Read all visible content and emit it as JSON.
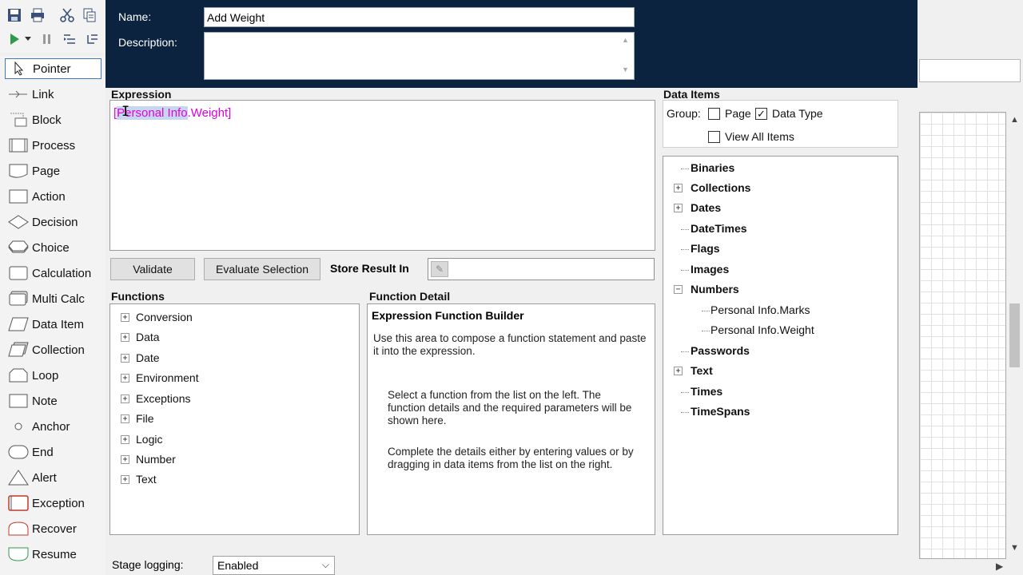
{
  "toolbar": {
    "icons": [
      "save-icon",
      "print-icon",
      "cut-icon",
      "copy-icon",
      "play-icon",
      "dropdown-icon",
      "pause-icon",
      "step-icon",
      "step-over-icon"
    ]
  },
  "palette": {
    "items": [
      {
        "label": "Pointer"
      },
      {
        "label": "Link"
      },
      {
        "label": "Block"
      },
      {
        "label": "Process"
      },
      {
        "label": "Page"
      },
      {
        "label": "Action"
      },
      {
        "label": "Decision"
      },
      {
        "label": "Choice"
      },
      {
        "label": "Calculation"
      },
      {
        "label": "Multi Calc"
      },
      {
        "label": "Data Item"
      },
      {
        "label": "Collection"
      },
      {
        "label": "Loop"
      },
      {
        "label": "Note"
      },
      {
        "label": "Anchor"
      },
      {
        "label": "End"
      },
      {
        "label": "Alert"
      },
      {
        "label": "Exception"
      },
      {
        "label": "Recover"
      },
      {
        "label": "Resume"
      }
    ],
    "selected": "Pointer"
  },
  "dialog": {
    "name_label": "Name:",
    "name_value": "Add Weight",
    "description_label": "Description:",
    "description_value": "",
    "expression_label": "Expression",
    "expression": {
      "open": "[",
      "highlighted": "Personal Info",
      "rest": ".Weight]"
    },
    "validate_button": "Validate",
    "evaluate_button": "Evaluate Selection",
    "store_result_label": "Store Result In",
    "store_result_value": "",
    "functions_label": "Functions",
    "functions": [
      {
        "label": "Conversion"
      },
      {
        "label": "Data"
      },
      {
        "label": "Date"
      },
      {
        "label": "Environment"
      },
      {
        "label": "Exceptions"
      },
      {
        "label": "File"
      },
      {
        "label": "Logic"
      },
      {
        "label": "Number"
      },
      {
        "label": "Text"
      }
    ],
    "function_detail_label": "Function Detail",
    "function_detail": {
      "title": "Expression Function Builder",
      "p1": "Use this area to compose a function statement and paste it into the expression.",
      "p2": "Select a function from the list on the left. The function details and the required parameters will be shown here.",
      "p3": "Complete the details either by entering values or by dragging in data items from the list on the right."
    },
    "data_items_label": "Data Items",
    "group_label": "Group:",
    "group_page": {
      "label": "Page",
      "checked": false
    },
    "group_data_type": {
      "label": "Data Type",
      "checked": true
    },
    "view_all": {
      "label": "View All Items",
      "checked": false
    },
    "data_items": [
      {
        "label": "Binaries",
        "expander": "none"
      },
      {
        "label": "Collections",
        "expander": "plus"
      },
      {
        "label": "Dates",
        "expander": "plus"
      },
      {
        "label": "DateTimes",
        "expander": "none"
      },
      {
        "label": "Flags",
        "expander": "none"
      },
      {
        "label": "Images",
        "expander": "none"
      },
      {
        "label": "Numbers",
        "expander": "minus"
      },
      {
        "label": "Personal Info.Marks",
        "expander": "child"
      },
      {
        "label": "Personal Info.Weight",
        "expander": "child"
      },
      {
        "label": "Passwords",
        "expander": "none"
      },
      {
        "label": "Text",
        "expander": "plus"
      },
      {
        "label": "Times",
        "expander": "none"
      },
      {
        "label": "TimeSpans",
        "expander": "none"
      }
    ],
    "stage_logging_label": "Stage logging:",
    "stage_logging_value": "Enabled"
  },
  "colors": {
    "header_bg": "#0c2340",
    "expression_text": "#e000e0",
    "selection_highlight": "#c7d7f0"
  }
}
